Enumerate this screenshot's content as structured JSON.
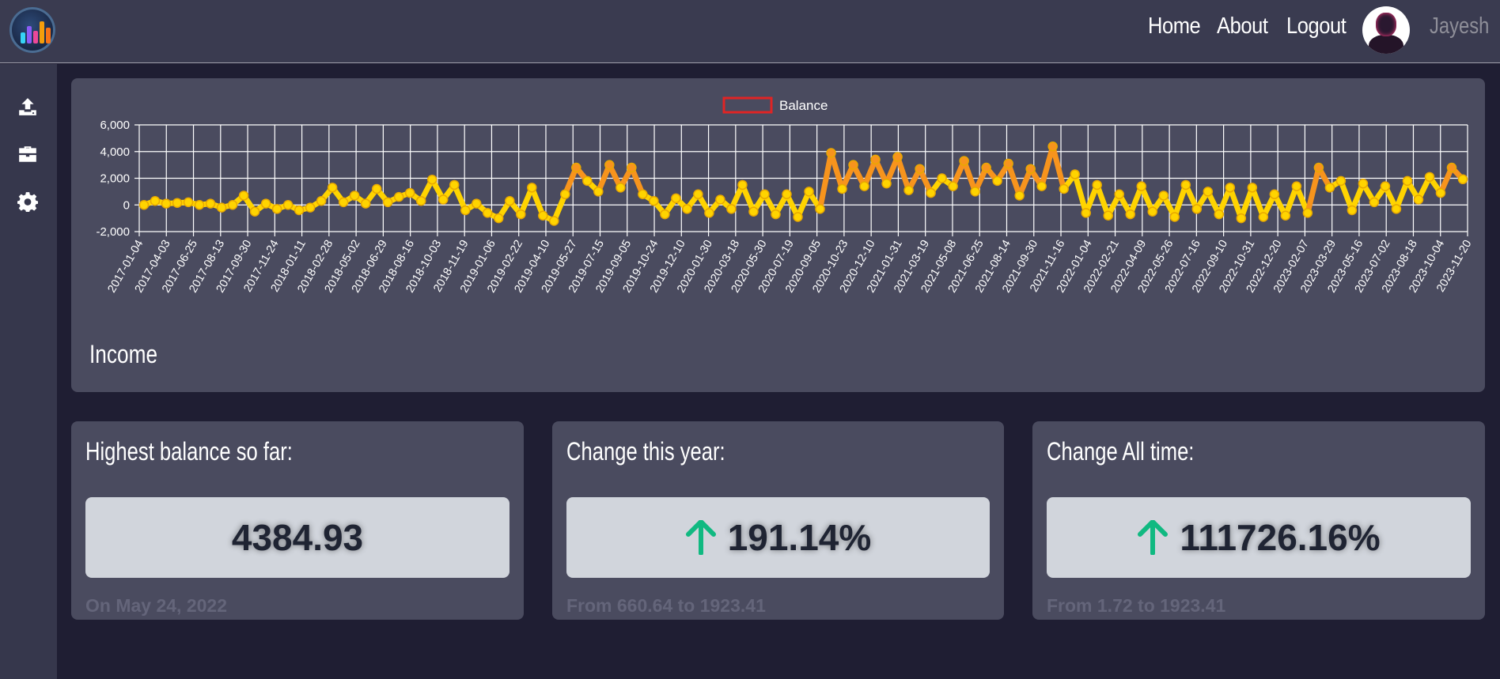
{
  "header": {
    "nav": [
      {
        "label": "Home"
      },
      {
        "label": "About"
      },
      {
        "label": "Logout"
      }
    ],
    "username": "Jayesh",
    "logo_icon": "app-logo-icon",
    "avatar_icon": "user-avatar"
  },
  "sidebar": {
    "items": [
      {
        "icon": "upload-icon"
      },
      {
        "icon": "toolbox-icon"
      },
      {
        "icon": "gear-icon"
      }
    ]
  },
  "chart_card": {
    "section_label": "Income"
  },
  "cards": [
    {
      "title": "Highest balance so far:",
      "value": "4384.93",
      "trend": "none",
      "subtitle": "On May 24, 2022"
    },
    {
      "title": "Change this year:",
      "value": "191.14%",
      "trend": "up",
      "subtitle": "From 660.64 to 1923.41"
    },
    {
      "title": "Change All time:",
      "value": "111726.16%",
      "trend": "up",
      "subtitle": "From 1.72 to 1923.41"
    }
  ],
  "colors": {
    "accent_up": "#10b981",
    "legend_border": "#e02424",
    "line_low": "#ffd400",
    "line_high": "#f7941d"
  },
  "chart_data": {
    "type": "line",
    "legend": "Balance",
    "legend_position": "top-center",
    "grid": true,
    "ylim": [
      -2000,
      6000
    ],
    "y_ticks": [
      "6,000",
      "4,000",
      "2,000",
      "0",
      "-2,000"
    ],
    "x_tick_labels": [
      "2017-01-04",
      "2017-04-03",
      "2017-06-25",
      "2017-08-13",
      "2017-09-30",
      "2017-11-24",
      "2018-01-11",
      "2018-02-28",
      "2018-05-02",
      "2018-06-29",
      "2018-08-16",
      "2018-10-03",
      "2018-11-19",
      "2019-01-06",
      "2019-02-22",
      "2019-04-10",
      "2019-05-27",
      "2019-07-15",
      "2019-09-05",
      "2019-10-24",
      "2019-12-10",
      "2020-01-30",
      "2020-03-18",
      "2020-05-30",
      "2020-07-19",
      "2020-09-05",
      "2020-10-23",
      "2020-12-10",
      "2021-01-31",
      "2021-03-19",
      "2021-05-08",
      "2021-06-25",
      "2021-08-14",
      "2021-09-30",
      "2021-11-16",
      "2022-01-04",
      "2022-02-21",
      "2022-04-09",
      "2022-05-26",
      "2022-07-16",
      "2022-09-10",
      "2022-10-31",
      "2022-12-20",
      "2023-02-07",
      "2023-03-29",
      "2023-05-16",
      "2023-07-02",
      "2023-08-18",
      "2023-10-04",
      "2023-11-20"
    ],
    "series": [
      {
        "name": "Balance",
        "values": [
          0,
          300,
          100,
          150,
          200,
          0,
          100,
          -200,
          0,
          700,
          -500,
          100,
          -300,
          0,
          -400,
          -200,
          300,
          1300,
          200,
          700,
          100,
          1200,
          200,
          600,
          900,
          300,
          1900,
          400,
          1500,
          -400,
          100,
          -600,
          -1000,
          300,
          -700,
          1300,
          -800,
          -1200,
          800,
          2800,
          1800,
          1000,
          3000,
          1300,
          2800,
          800,
          300,
          -700,
          500,
          -300,
          800,
          -600,
          400,
          -300,
          1500,
          -500,
          800,
          -700,
          800,
          -900,
          1000,
          -300,
          3900,
          1200,
          3000,
          1400,
          3400,
          1600,
          3600,
          1100,
          2700,
          900,
          2000,
          1400,
          3300,
          1000,
          2800,
          1800,
          3100,
          700,
          2700,
          1400,
          4384.93,
          1200,
          2300,
          -600,
          1500,
          -800,
          800,
          -700,
          1400,
          -500,
          700,
          -900,
          1500,
          -300,
          1000,
          -700,
          1300,
          -1000,
          1300,
          -900,
          800,
          -800,
          1400,
          -600,
          2800,
          1300,
          1800,
          -400,
          1600,
          200,
          1400,
          -300,
          1800,
          400,
          2100,
          900,
          2800,
          1923.41
        ]
      }
    ]
  }
}
